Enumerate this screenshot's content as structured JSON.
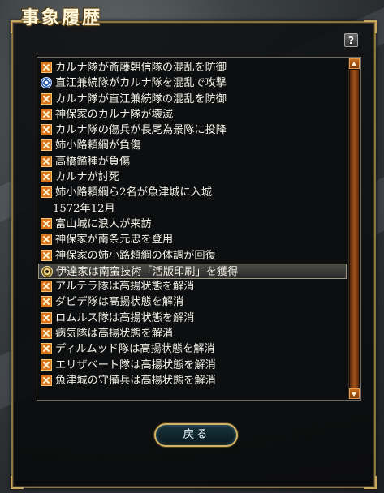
{
  "window": {
    "title": "事象履歴"
  },
  "help_button": {
    "label": "?"
  },
  "log": [
    {
      "icon": "pinwheel-icon",
      "text": "カルナ隊が斎藤朝信隊の混乱を防御"
    },
    {
      "icon": "family-crest-icon",
      "text": "直江兼続隊がカルナ隊を混乱で攻撃"
    },
    {
      "icon": "pinwheel-icon",
      "text": "カルナ隊が直江兼続隊の混乱を防御"
    },
    {
      "icon": "pinwheel-icon",
      "text": "神保家のカルナ隊が壊滅"
    },
    {
      "icon": "pinwheel-icon",
      "text": "カルナ隊の傷兵が長尾為景隊に投降"
    },
    {
      "icon": "pinwheel-icon",
      "text": "姉小路頼綱が負傷"
    },
    {
      "icon": "pinwheel-icon",
      "text": "高橋鑑種が負傷"
    },
    {
      "icon": "pinwheel-icon",
      "text": "カルナが討死"
    },
    {
      "icon": "pinwheel-icon",
      "text": "姉小路頼綱ら2名が魚津城に入城"
    },
    {
      "icon": "",
      "text": "1572年12月"
    },
    {
      "icon": "pinwheel-icon",
      "text": "富山城に浪人が来訪"
    },
    {
      "icon": "pinwheel-icon",
      "text": "神保家が南条元忠を登用"
    },
    {
      "icon": "pinwheel-icon",
      "text": "神保家の姉小路頼綱の体調が回復"
    },
    {
      "icon": "gear-crest-icon",
      "text": "伊達家は南蛮技術「活版印刷」を獲得"
    },
    {
      "icon": "pinwheel-icon",
      "text": "アルテラ隊は高揚状態を解消"
    },
    {
      "icon": "pinwheel-icon",
      "text": "ダビデ隊は高揚状態を解消"
    },
    {
      "icon": "pinwheel-icon",
      "text": "ロムルス隊は高揚状態を解消"
    },
    {
      "icon": "pinwheel-icon",
      "text": "病気隊は高揚状態を解消"
    },
    {
      "icon": "pinwheel-icon",
      "text": "ディルムッド隊は高揚状態を解消"
    },
    {
      "icon": "pinwheel-icon",
      "text": "エリザベート隊は高揚状態を解消"
    },
    {
      "icon": "pinwheel-icon",
      "text": "魚津城の守備兵は高揚状態を解消"
    }
  ],
  "selected_index": 13,
  "back_button": {
    "label": "戻る"
  },
  "colors": {
    "panel_border": "#8a7440",
    "pinwheel": "#d9741c",
    "crest_blue": "#2b5fb8",
    "scrollbar": "#a0501a",
    "button_border": "#d2b468"
  }
}
